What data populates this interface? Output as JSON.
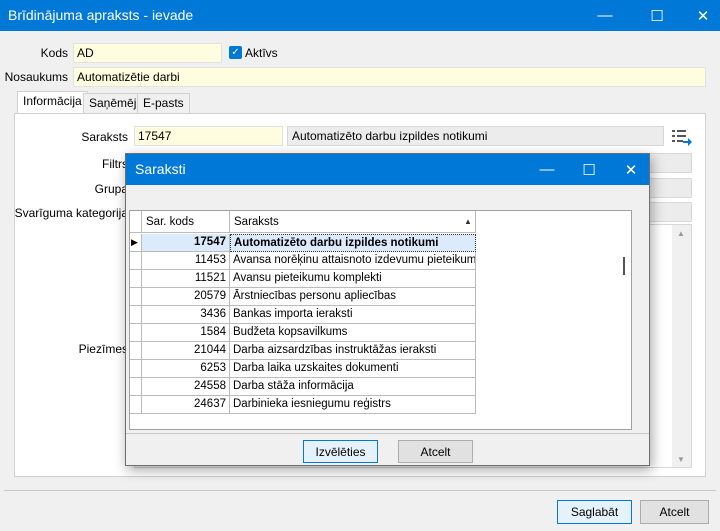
{
  "window": {
    "title": "Brīdinājuma apraksts - ievade",
    "min_glyph": "—",
    "max_glyph": "☐",
    "close_glyph": "✕"
  },
  "form": {
    "kods_label": "Kods",
    "kods_value": "AD",
    "aktivs_label": "Aktīvs",
    "aktivs_checked": true,
    "nosaukums_label": "Nosaukums",
    "nosaukums_value": "Automatizētie darbi"
  },
  "tabs": [
    {
      "label": "Informācija",
      "active": true
    },
    {
      "label": "Saņēmēji",
      "active": false
    },
    {
      "label": "E-pasts",
      "active": false
    }
  ],
  "info": {
    "saraksts_label": "Saraksts",
    "saraksts_code": "17547",
    "saraksts_name": "Automatizēto darbu izpildes notikumi",
    "filtrs_label": "Filtrs",
    "grupa_label": "Grupa",
    "svarigums_label": "Svarīguma kategorija",
    "piezimes_label": "Piezīmes"
  },
  "buttons": {
    "save": "Saglabāt",
    "cancel": "Atcelt"
  },
  "dialog": {
    "title": "Saraksti",
    "col_code": "Sar. kods",
    "col_name": "Saraksts",
    "sort_glyph": "▲",
    "rows": [
      {
        "code": "17547",
        "name": "Automatizēto darbu izpildes notikumi",
        "selected": true
      },
      {
        "code": "11453",
        "name": "Avansa norēķinu attaisnoto izdevumu pieteikum…",
        "selected": false
      },
      {
        "code": "11521",
        "name": "Avansu pieteikumu komplekti",
        "selected": false
      },
      {
        "code": "20579",
        "name": "Ārstniecības personu apliecības",
        "selected": false
      },
      {
        "code": "3436",
        "name": "Bankas importa ieraksti",
        "selected": false
      },
      {
        "code": "1584",
        "name": "Budžeta kopsavilkums",
        "selected": false
      },
      {
        "code": "21044",
        "name": "Darba aizsardzības instruktāžas ieraksti",
        "selected": false
      },
      {
        "code": "6253",
        "name": "Darba laika uzskaites dokumenti",
        "selected": false
      },
      {
        "code": "24558",
        "name": "Darba stāža informācija",
        "selected": false
      },
      {
        "code": "24637",
        "name": "Darbinieka iesniegumu reģistrs",
        "selected": false
      }
    ],
    "select_button": "Izvēlēties",
    "cancel_button": "Atcelt"
  },
  "icons": {
    "list_select": "list-select-icon",
    "check": "check-icon",
    "row_pointer": "row-pointer-icon"
  },
  "colors": {
    "accent": "#0078d7",
    "required_field": "#fffde0",
    "selected_row": "#dcebfc"
  }
}
